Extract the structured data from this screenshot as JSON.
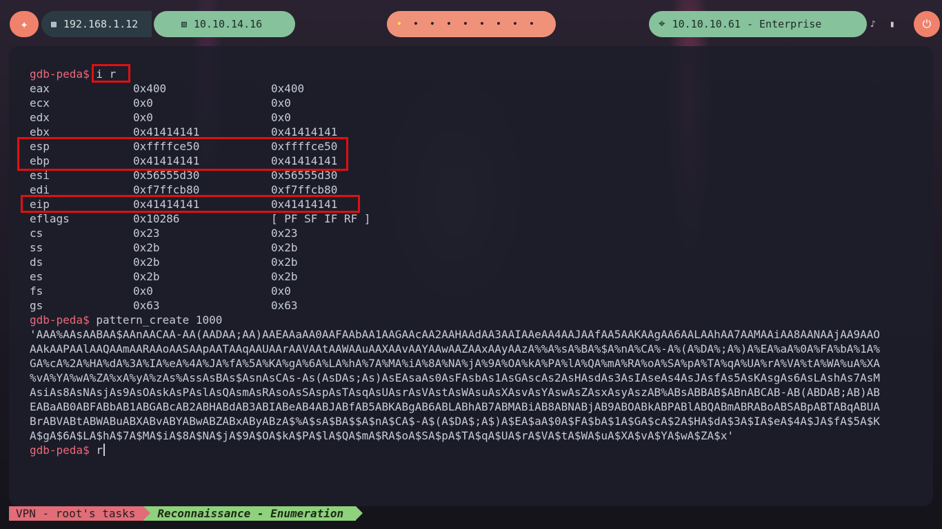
{
  "topbar": {
    "local_ip": "192.168.1.12",
    "vpn_ip": "10.10.14.16",
    "target": "10.10.10.61 - Enterprise",
    "workspaces": [
      "•",
      "•",
      "•",
      "•",
      "•",
      "•",
      "•",
      "•",
      "•"
    ]
  },
  "terminal": {
    "prompt": "gdb-peda$",
    "cmd1": "i r",
    "registers": [
      {
        "name": "eax",
        "hex": "0x400",
        "val": "0x400"
      },
      {
        "name": "ecx",
        "hex": "0x0",
        "val": "0x0"
      },
      {
        "name": "edx",
        "hex": "0x0",
        "val": "0x0"
      },
      {
        "name": "ebx",
        "hex": "0x41414141",
        "val": "0x41414141"
      },
      {
        "name": "esp",
        "hex": "0xffffce50",
        "val": "0xffffce50"
      },
      {
        "name": "ebp",
        "hex": "0x41414141",
        "val": "0x41414141"
      },
      {
        "name": "esi",
        "hex": "0x56555d30",
        "val": "0x56555d30"
      },
      {
        "name": "edi",
        "hex": "0xf7ffcb80",
        "val": "0xf7ffcb80"
      },
      {
        "name": "eip",
        "hex": "0x41414141",
        "val": "0x41414141"
      },
      {
        "name": "eflags",
        "hex": "0x10286",
        "val": "[ PF SF IF RF ]"
      },
      {
        "name": "cs",
        "hex": "0x23",
        "val": "0x23"
      },
      {
        "name": "ss",
        "hex": "0x2b",
        "val": "0x2b"
      },
      {
        "name": "ds",
        "hex": "0x2b",
        "val": "0x2b"
      },
      {
        "name": "es",
        "hex": "0x2b",
        "val": "0x2b"
      },
      {
        "name": "fs",
        "hex": "0x0",
        "val": "0x0"
      },
      {
        "name": "gs",
        "hex": "0x63",
        "val": "0x63"
      }
    ],
    "cmd2": "pattern_create 1000",
    "pattern_lines": [
      "'AAA%AAsAABAA$AAnAACAA-AA(AADAA;AA)AAEAAaAA0AAFAAbAA1AAGAAcAA2AAHAAdAA3AAIAAeAA4AAJAAfAA5AAKAAgAA6AALAAhAA7AAMAAiAA8AANAAjAA9AAO",
      "AAkAAPAAlAAQAAmAARAAoAASAApAATAAqAAUAArAAVAAtAAWAAuAAXAAvAAYAAwAAZAAxAAyAAzA%%A%sA%BA%$A%nA%CA%-A%(A%DA%;A%)A%EA%aA%0A%FA%bA%1A%",
      "GA%cA%2A%HA%dA%3A%IA%eA%4A%JA%fA%5A%KA%gA%6A%LA%hA%7A%MA%iA%8A%NA%jA%9A%OA%kA%PA%lA%QA%mA%RA%oA%SA%pA%TA%qA%UA%rA%VA%tA%WA%uA%XA",
      "%vA%YA%wA%ZA%xA%yA%zAs%AssAsBAs$AsnAsCAs-As(AsDAs;As)AsEAsaAs0AsFAsbAs1AsGAscAs2AsHAsdAs3AsIAseAs4AsJAsfAs5AsKAsgAs6AsLAshAs7AsM",
      "AsiAs8AsNAsjAs9AsOAskAsPAslAsQAsmAsRAsoAsSAspAsTAsqAsUAsrAsVAstAsWAsuAsXAsvAsYAswAsZAsxAsyAszAB%ABsABBAB$ABnABCAB-AB(ABDAB;AB)AB",
      "EABaAB0ABFABbAB1ABGABcAB2ABHABdAB3ABIABeAB4ABJABfAB5ABKABgAB6ABLABhAB7ABMABiAB8ABNABjAB9ABOABkABPABlABQABmABRABoABSABpABTABqABUA",
      "BrABVABtABWABuABXABvABYABwABZABxAByABzA$%A$sA$BA$$A$nA$CA$-A$(A$DA$;A$)A$EA$aA$0A$FA$bA$1A$GA$cA$2A$HA$dA$3A$IA$eA$4A$JA$fA$5A$K",
      "A$gA$6A$LA$hA$7A$MA$iA$8A$NA$jA$9A$OA$kA$PA$lA$QA$mA$RA$oA$SA$pA$TA$qA$UA$rA$VA$tA$WA$uA$XA$vA$YA$wA$ZA$x'"
    ],
    "cmd3": "r"
  },
  "statusbar": {
    "vpn": "VPN - root's tasks",
    "mode": "Reconnaissance - Enumeration"
  },
  "colors": {
    "accent_salmon": "#f0826c",
    "accent_green": "#86c29c",
    "highlight_red": "#e01010",
    "prompt": "#ec6a7a"
  }
}
